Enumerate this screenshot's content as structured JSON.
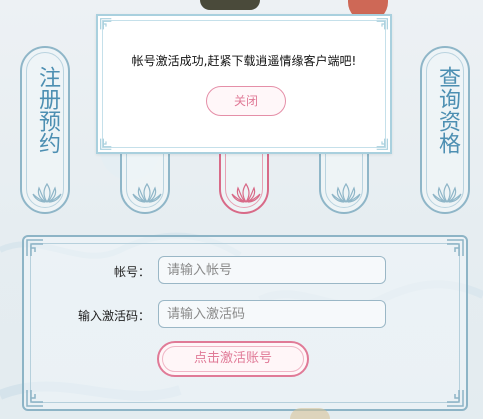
{
  "pillars": [
    {
      "label": "注册预约"
    },
    {
      "label": ""
    },
    {
      "label": ""
    },
    {
      "label": ""
    },
    {
      "label": "查询资格"
    }
  ],
  "form": {
    "account_label": "帐号：",
    "account_placeholder": "请输入帐号",
    "code_label": "输入激活码：",
    "code_placeholder": "请输入激活码",
    "submit_label": "点击激活账号"
  },
  "dialog": {
    "message": "帐号激活成功,赶紧下载逍遥情缘客户端吧!",
    "close_label": "关闭"
  },
  "colors": {
    "accent_pink": "#e07a97",
    "accent_blue": "#4d8fb2"
  }
}
